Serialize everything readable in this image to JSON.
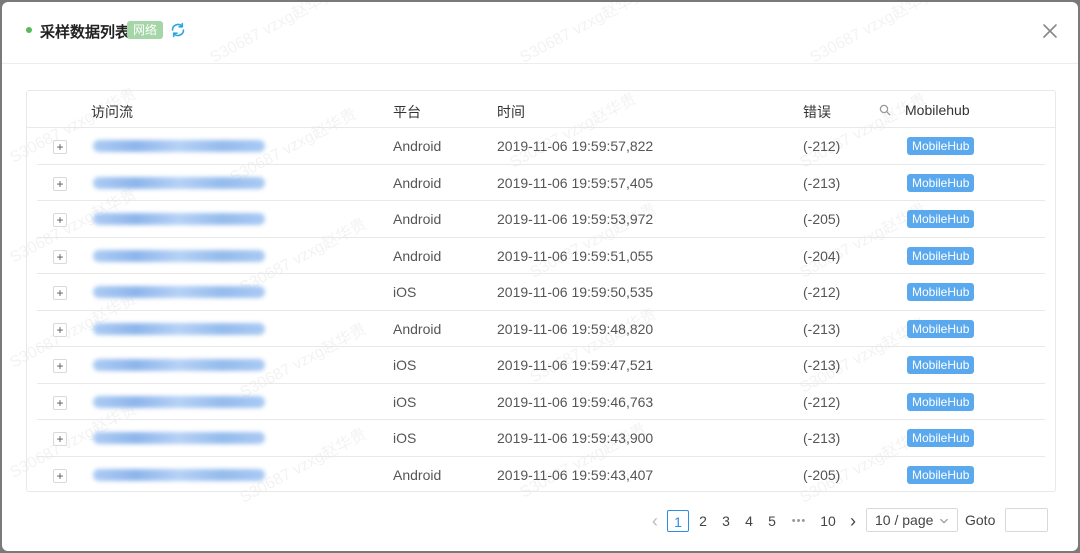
{
  "header": {
    "title": "采样数据列表",
    "tag": "网络"
  },
  "columns": [
    "访问流",
    "平台",
    "时间",
    "错误",
    "Mobilehub"
  ],
  "rows": [
    {
      "expand": "+",
      "platform": "Android",
      "time": "2019-11-06 19:59:57,822",
      "error": "(-212)",
      "hub": "MobileHub"
    },
    {
      "expand": "+",
      "platform": "Android",
      "time": "2019-11-06 19:59:57,405",
      "error": "(-213)",
      "hub": "MobileHub"
    },
    {
      "expand": "+",
      "platform": "Android",
      "time": "2019-11-06 19:59:53,972",
      "error": "(-205)",
      "hub": "MobileHub"
    },
    {
      "expand": "+",
      "platform": "Android",
      "time": "2019-11-06 19:59:51,055",
      "error": "(-204)",
      "hub": "MobileHub"
    },
    {
      "expand": "+",
      "platform": "iOS",
      "time": "2019-11-06 19:59:50,535",
      "error": "(-212)",
      "hub": "MobileHub"
    },
    {
      "expand": "+",
      "platform": "Android",
      "time": "2019-11-06 19:59:48,820",
      "error": "(-213)",
      "hub": "MobileHub"
    },
    {
      "expand": "+",
      "platform": "iOS",
      "time": "2019-11-06 19:59:47,521",
      "error": "(-213)",
      "hub": "MobileHub"
    },
    {
      "expand": "+",
      "platform": "iOS",
      "time": "2019-11-06 19:59:46,763",
      "error": "(-212)",
      "hub": "MobileHub"
    },
    {
      "expand": "+",
      "platform": "iOS",
      "time": "2019-11-06 19:59:43,900",
      "error": "(-213)",
      "hub": "MobileHub"
    },
    {
      "expand": "+",
      "platform": "Android",
      "time": "2019-11-06 19:59:43,407",
      "error": "(-205)",
      "hub": "MobileHub"
    }
  ],
  "pagination": {
    "prev": "‹",
    "pages": [
      "1",
      "2",
      "3",
      "4",
      "5"
    ],
    "ellipsis": "•••",
    "last": "10",
    "next": "›",
    "page_size": "10 / page",
    "goto_label": "Goto",
    "goto_value": ""
  },
  "watermark": "S30687 vzxg赵华贵",
  "colors": {
    "accent": "#2b8de4",
    "badge": "#5aa9ef",
    "tag_green": "#a5d6a7"
  },
  "icons": {
    "close": "close-icon",
    "refresh": "refresh-icon",
    "search": "search-icon"
  }
}
